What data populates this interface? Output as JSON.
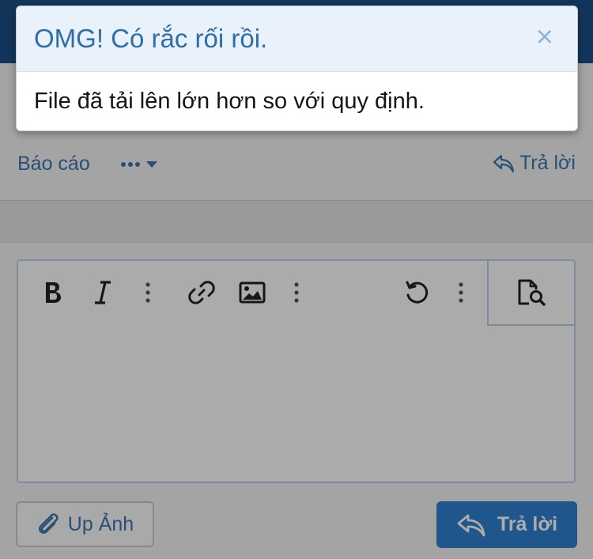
{
  "post_actions": {
    "report_label": "Báo cáo",
    "reply_label": "Trả lời"
  },
  "editor": {
    "toolbar": [
      "bold",
      "italic",
      "more",
      "link",
      "image",
      "more",
      "undo",
      "more",
      "preview"
    ]
  },
  "footer": {
    "upload_label": "Up Ảnh",
    "submit_label": "Trả lời"
  },
  "alert": {
    "title": "OMG! Có rắc rối rồi.",
    "message": "File đã tải lên lớn hơn so với quy định.",
    "close_symbol": "×"
  },
  "colors": {
    "link": "#3c76ac",
    "primary_button": "#2f80d0",
    "alert_title": "#2f6ea8",
    "alert_header_bg": "#e9f1fa"
  }
}
